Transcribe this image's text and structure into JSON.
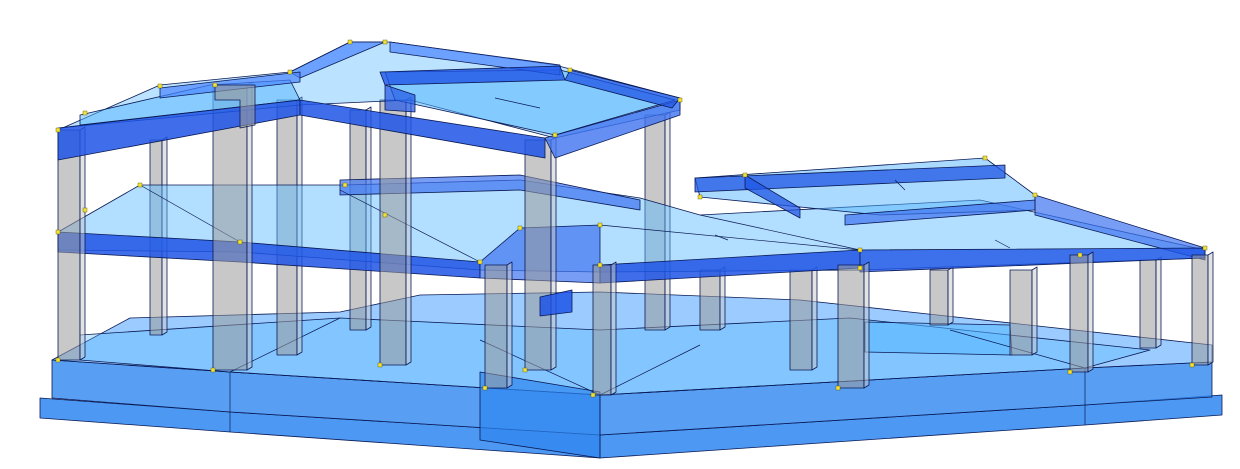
{
  "viewport": {
    "background": "#ffffff",
    "colors": {
      "slab_fill": "#55b6ff",
      "beam_fill": "#1f55e6",
      "beam_fill_light": "#3f73f0",
      "beam_top": "#4a86ff",
      "column_fill": "#9b9b9b",
      "column_side": "#c8c8c8",
      "foundation_fill": "#2e86f0",
      "foundation_top": "#4aa3ff",
      "edge": "#0a1a55",
      "node": "#f1e23a"
    }
  }
}
